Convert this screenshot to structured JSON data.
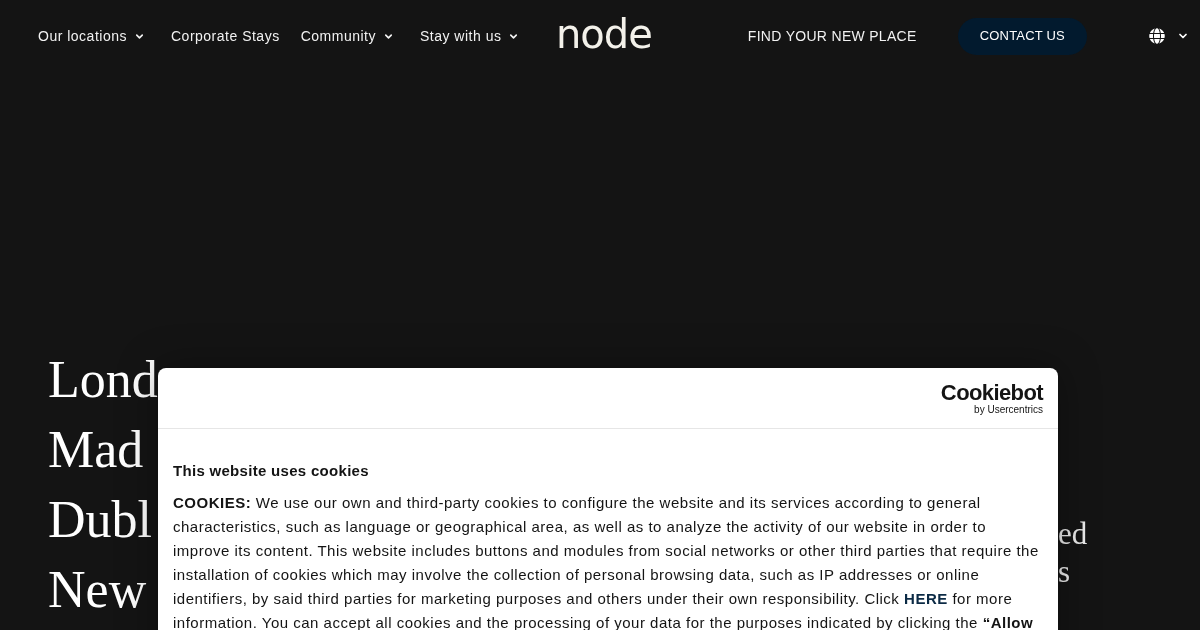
{
  "nav": {
    "items": [
      {
        "label": "Our locations",
        "has_dropdown": true
      },
      {
        "label": "Corporate Stays",
        "has_dropdown": false
      },
      {
        "label": "Community",
        "has_dropdown": true
      },
      {
        "label": "Stay with us",
        "has_dropdown": true
      }
    ],
    "logo": "node",
    "link": "FIND YOUR NEW PLACE",
    "cta": "CONTACT US"
  },
  "hero": {
    "cities": [
      "Lond",
      "Mad",
      "Dubl",
      "New"
    ],
    "fragments": [
      "ed",
      "s"
    ]
  },
  "cookie_dialog": {
    "logo": {
      "wordmark": "Cookiebot",
      "tagline": "by Usercentrics"
    },
    "title": "This website uses cookies",
    "body": {
      "before": "**COOKIES:** We use our own and third-party cookies to configure the website and its services according to general characteristics, such as language or geographical area, as well as to analyze the activity of our website in order to improve its content. This website includes buttons and modules from social networks or other third parties that require the installation of cookies which may involve the collection of personal browsing data, such as IP addresses or online identifiers, by said third parties for marketing purposes and others under their own responsibility. Click",
      "link": "HERE",
      "after": "for more information. You can accept all cookies and the processing of your data for the purposes indicated by clicking the **“Allow**"
    }
  }
}
